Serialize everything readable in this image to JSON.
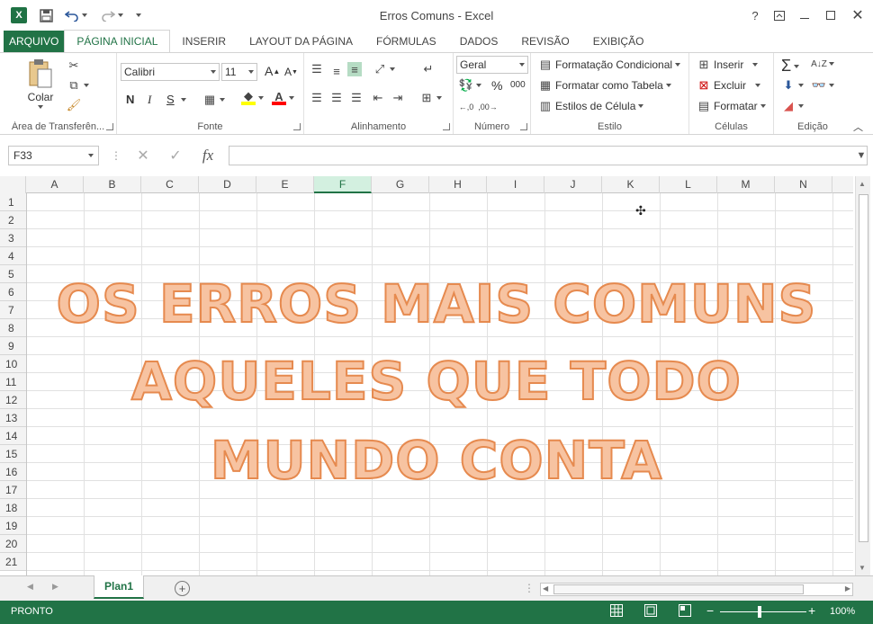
{
  "window": {
    "title": "Erros Comuns - Excel",
    "help": "?",
    "controls": [
      "ribbon-display",
      "minimize",
      "maximize",
      "close"
    ]
  },
  "quick_access": {
    "app_icon": "X",
    "save": "save-icon",
    "undo": "undo-icon",
    "redo": "redo-icon",
    "customize": "customize-icon"
  },
  "tabs": [
    "ARQUIVO",
    "PÁGINA INICIAL",
    "INSERIR",
    "LAYOUT DA PÁGINA",
    "FÓRMULAS",
    "DADOS",
    "REVISÃO",
    "EXIBIÇÃO"
  ],
  "active_tab": "PÁGINA INICIAL",
  "ribbon": {
    "clipboard": {
      "label": "Área de Transferên...",
      "paste": "Colar"
    },
    "font": {
      "label": "Fonte",
      "name": "Calibri",
      "size": "11",
      "bold": "N",
      "italic": "I",
      "underline": "S"
    },
    "alignment": {
      "label": "Alinhamento"
    },
    "number": {
      "label": "Número",
      "format": "Geral",
      "percent": "%",
      "thousands": "000"
    },
    "styles": {
      "label": "Estilo",
      "conditional": "Formatação Condicional",
      "as_table": "Formatar como Tabela",
      "cell_styles": "Estilos de Célula"
    },
    "cells": {
      "label": "Células",
      "insert": "Inserir",
      "delete": "Excluir",
      "format": "Formatar"
    },
    "editing": {
      "label": "Edição"
    }
  },
  "formula_bar": {
    "name_box": "F33",
    "value": "",
    "fx": "fx"
  },
  "columns": [
    "A",
    "B",
    "C",
    "D",
    "E",
    "F",
    "G",
    "H",
    "I",
    "J",
    "K",
    "L",
    "M",
    "N"
  ],
  "selected_column": "F",
  "rows": [
    "1",
    "2",
    "3",
    "4",
    "5",
    "6",
    "7",
    "8",
    "9",
    "10",
    "11",
    "12",
    "13",
    "14",
    "15",
    "16",
    "17",
    "18",
    "19",
    "20",
    "21"
  ],
  "wordart": [
    "OS ERROS MAIS COMUNS",
    "AQUELES QUE TODO",
    "MUNDO CONTA"
  ],
  "wordart_colors": {
    "fill": "#f7c3a1",
    "outline": "#e68a4f"
  },
  "sheet": {
    "tab": "Plan1"
  },
  "status": {
    "mode": "PRONTO",
    "zoom": "100%"
  },
  "colors": {
    "accent": "#217346"
  }
}
